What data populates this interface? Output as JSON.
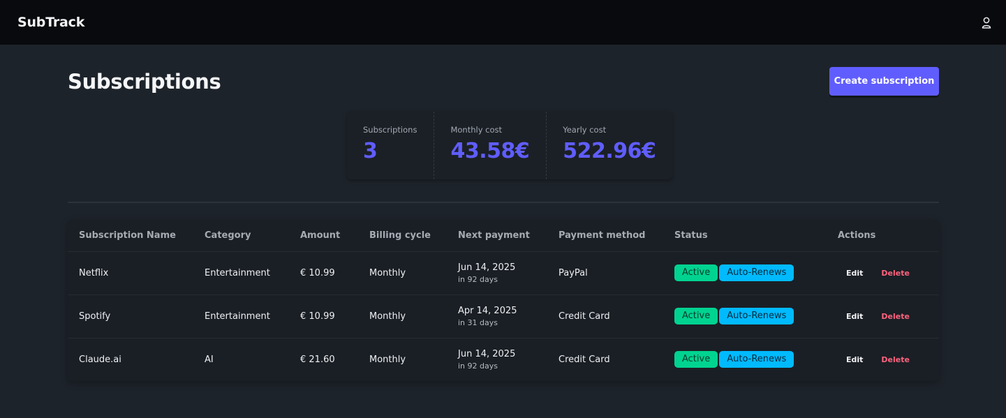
{
  "navbar": {
    "brand": "SubTrack",
    "user_icon": "user-icon"
  },
  "page": {
    "title": "Subscriptions",
    "create_button": "Create subscription"
  },
  "stats": [
    {
      "title": "Subscriptions",
      "value": "3"
    },
    {
      "title": "Monthly cost",
      "value": "43.58€"
    },
    {
      "title": "Yearly cost",
      "value": "522.96€"
    }
  ],
  "table": {
    "headers": [
      "Subscription Name",
      "Category",
      "Amount",
      "Billing cycle",
      "Next payment",
      "Payment method",
      "Status",
      "Actions"
    ],
    "rows": [
      {
        "name": "Netflix",
        "category": "Entertainment",
        "amount": "€ 10.99",
        "cycle": "Monthly",
        "next_date": "Jun 14, 2025",
        "next_in": "in 92 days",
        "method": "PayPal",
        "status": "Active",
        "renew": "Auto-Renews",
        "edit": "Edit",
        "delete": "Delete"
      },
      {
        "name": "Spotify",
        "category": "Entertainment",
        "amount": "€ 10.99",
        "cycle": "Monthly",
        "next_date": "Apr 14, 2025",
        "next_in": "in 31 days",
        "method": "Credit Card",
        "status": "Active",
        "renew": "Auto-Renews",
        "edit": "Edit",
        "delete": "Delete"
      },
      {
        "name": "Claude.ai",
        "category": "AI",
        "amount": "€ 21.60",
        "cycle": "Monthly",
        "next_date": "Jun 14, 2025",
        "next_in": "in 92 days",
        "method": "Credit Card",
        "status": "Active",
        "renew": "Auto-Renews",
        "edit": "Edit",
        "delete": "Delete"
      }
    ]
  },
  "colors": {
    "primary": "#605dff",
    "success": "#00d390",
    "info": "#00bafe",
    "error": "#ff627d",
    "background": "#1d232a",
    "navbar": "#080a0d"
  }
}
